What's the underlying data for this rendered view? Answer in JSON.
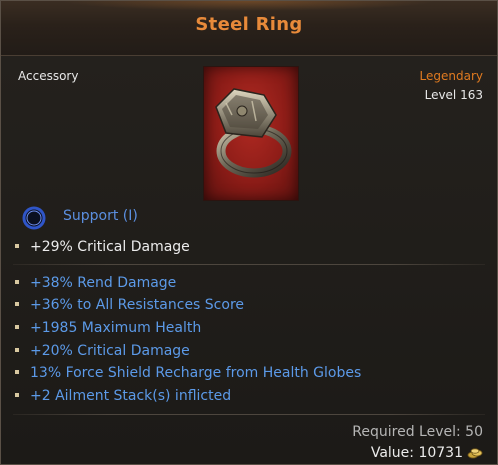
{
  "item": {
    "name": "Steel Ring",
    "type": "Accessory",
    "rarity": "Legendary",
    "level": "Level 163",
    "image_icon": "steel-ring-icon"
  },
  "support": {
    "icon": "support-ring-icon",
    "label": "Support (I)"
  },
  "implicit_stats": [
    "+29% Critical Damage"
  ],
  "affix_stats": [
    "+38% Rend Damage",
    "+36% to All Resistances Score",
    "+1985 Maximum Health",
    "+20% Critical Damage",
    "13% Force Shield Recharge from Health Globes",
    "+2 Ailment Stack(s) inflicted"
  ],
  "footer": {
    "required_level": "Required Level: 50",
    "value": "Value: 10731",
    "currency_icon": "gold-coins-icon"
  },
  "colors": {
    "title": "#e88a3a",
    "rarity": "#e07a20",
    "affix": "#5c9ae8",
    "support": "#5b8fe0"
  }
}
